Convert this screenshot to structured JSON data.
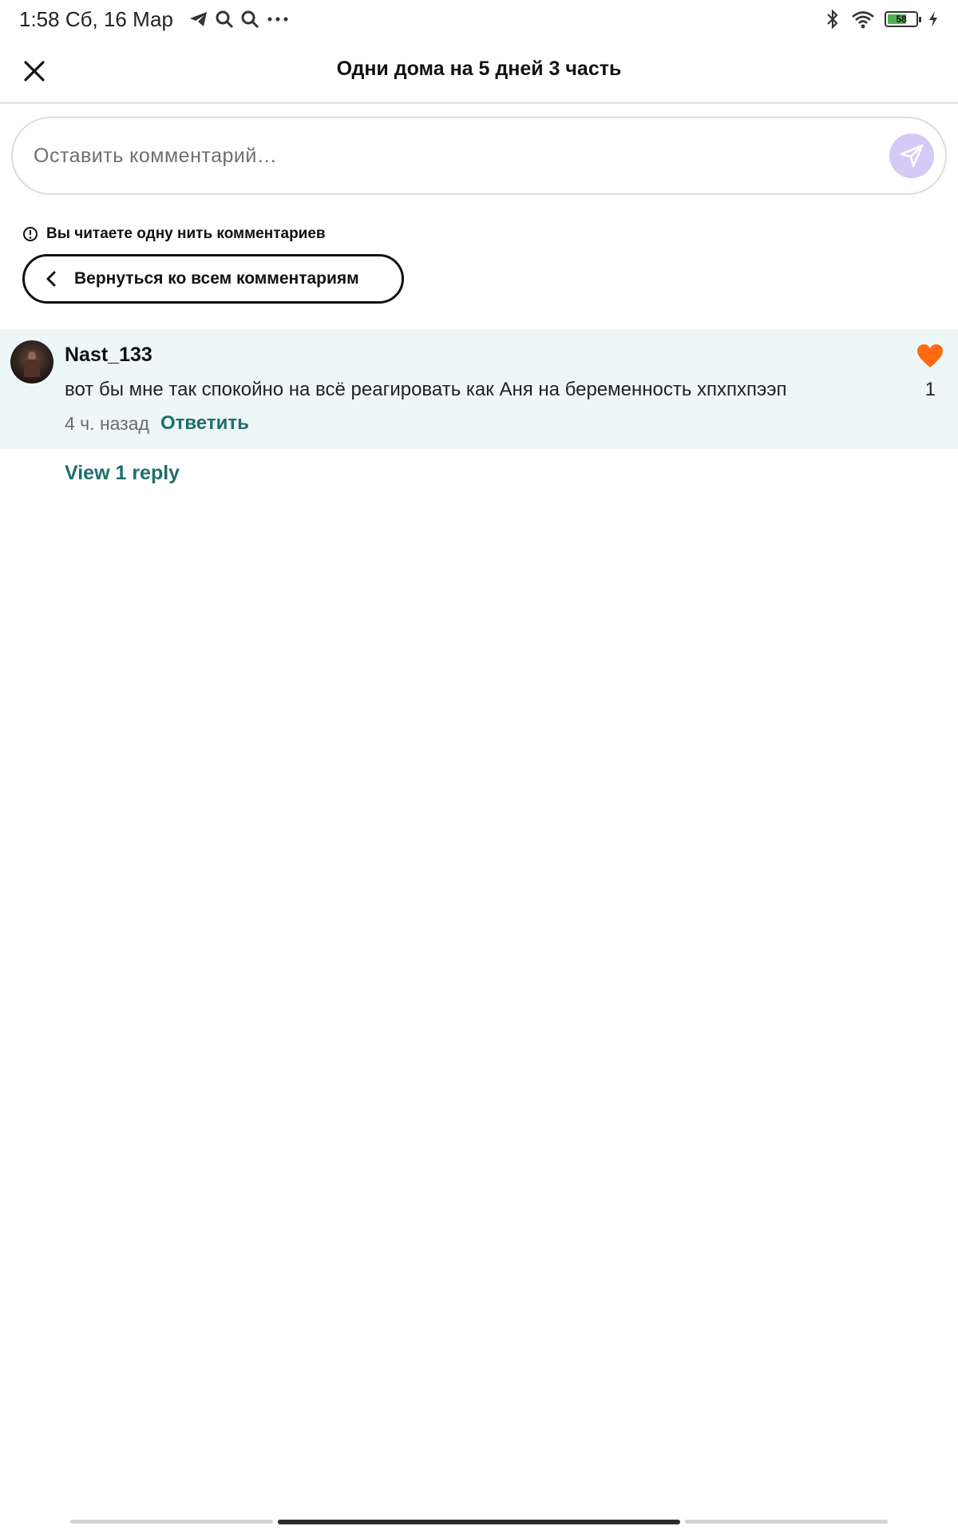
{
  "status_bar": {
    "time_date": "1:58 Сб, 16 Мар",
    "icons": [
      "telegram-icon",
      "search-icon",
      "search-icon",
      "more-icon"
    ],
    "right_icons": [
      "bluetooth-icon",
      "wifi-icon",
      "battery-icon",
      "charging-icon"
    ],
    "battery_level": "58"
  },
  "header": {
    "title": "Одни дома на 5 дней 3 часть",
    "close_icon": "close-icon"
  },
  "comment_input": {
    "placeholder": "Оставить комментарий…",
    "send_icon": "send-icon",
    "send_color": "#d5c9f7"
  },
  "thread": {
    "notice": "Вы читаете одну нить комментариев",
    "notice_icon": "info-icon",
    "back_label": "Вернуться ко всем комментариям",
    "back_icon": "chevron-left-icon"
  },
  "comment": {
    "username": "Nast_133",
    "text": "вот бы мне так спокойно на всё реагировать как Аня на беременность хпхпхпээп",
    "time": "4 ч. назад",
    "reply_label": "Ответить",
    "like_count": "1",
    "like_icon": "heart-icon",
    "like_color": "#ff6a13",
    "background": "#eef7f8"
  },
  "replies": {
    "view_label": "View 1 reply"
  },
  "colors": {
    "accent": "#1f6e6c",
    "heart": "#ff6a13"
  }
}
